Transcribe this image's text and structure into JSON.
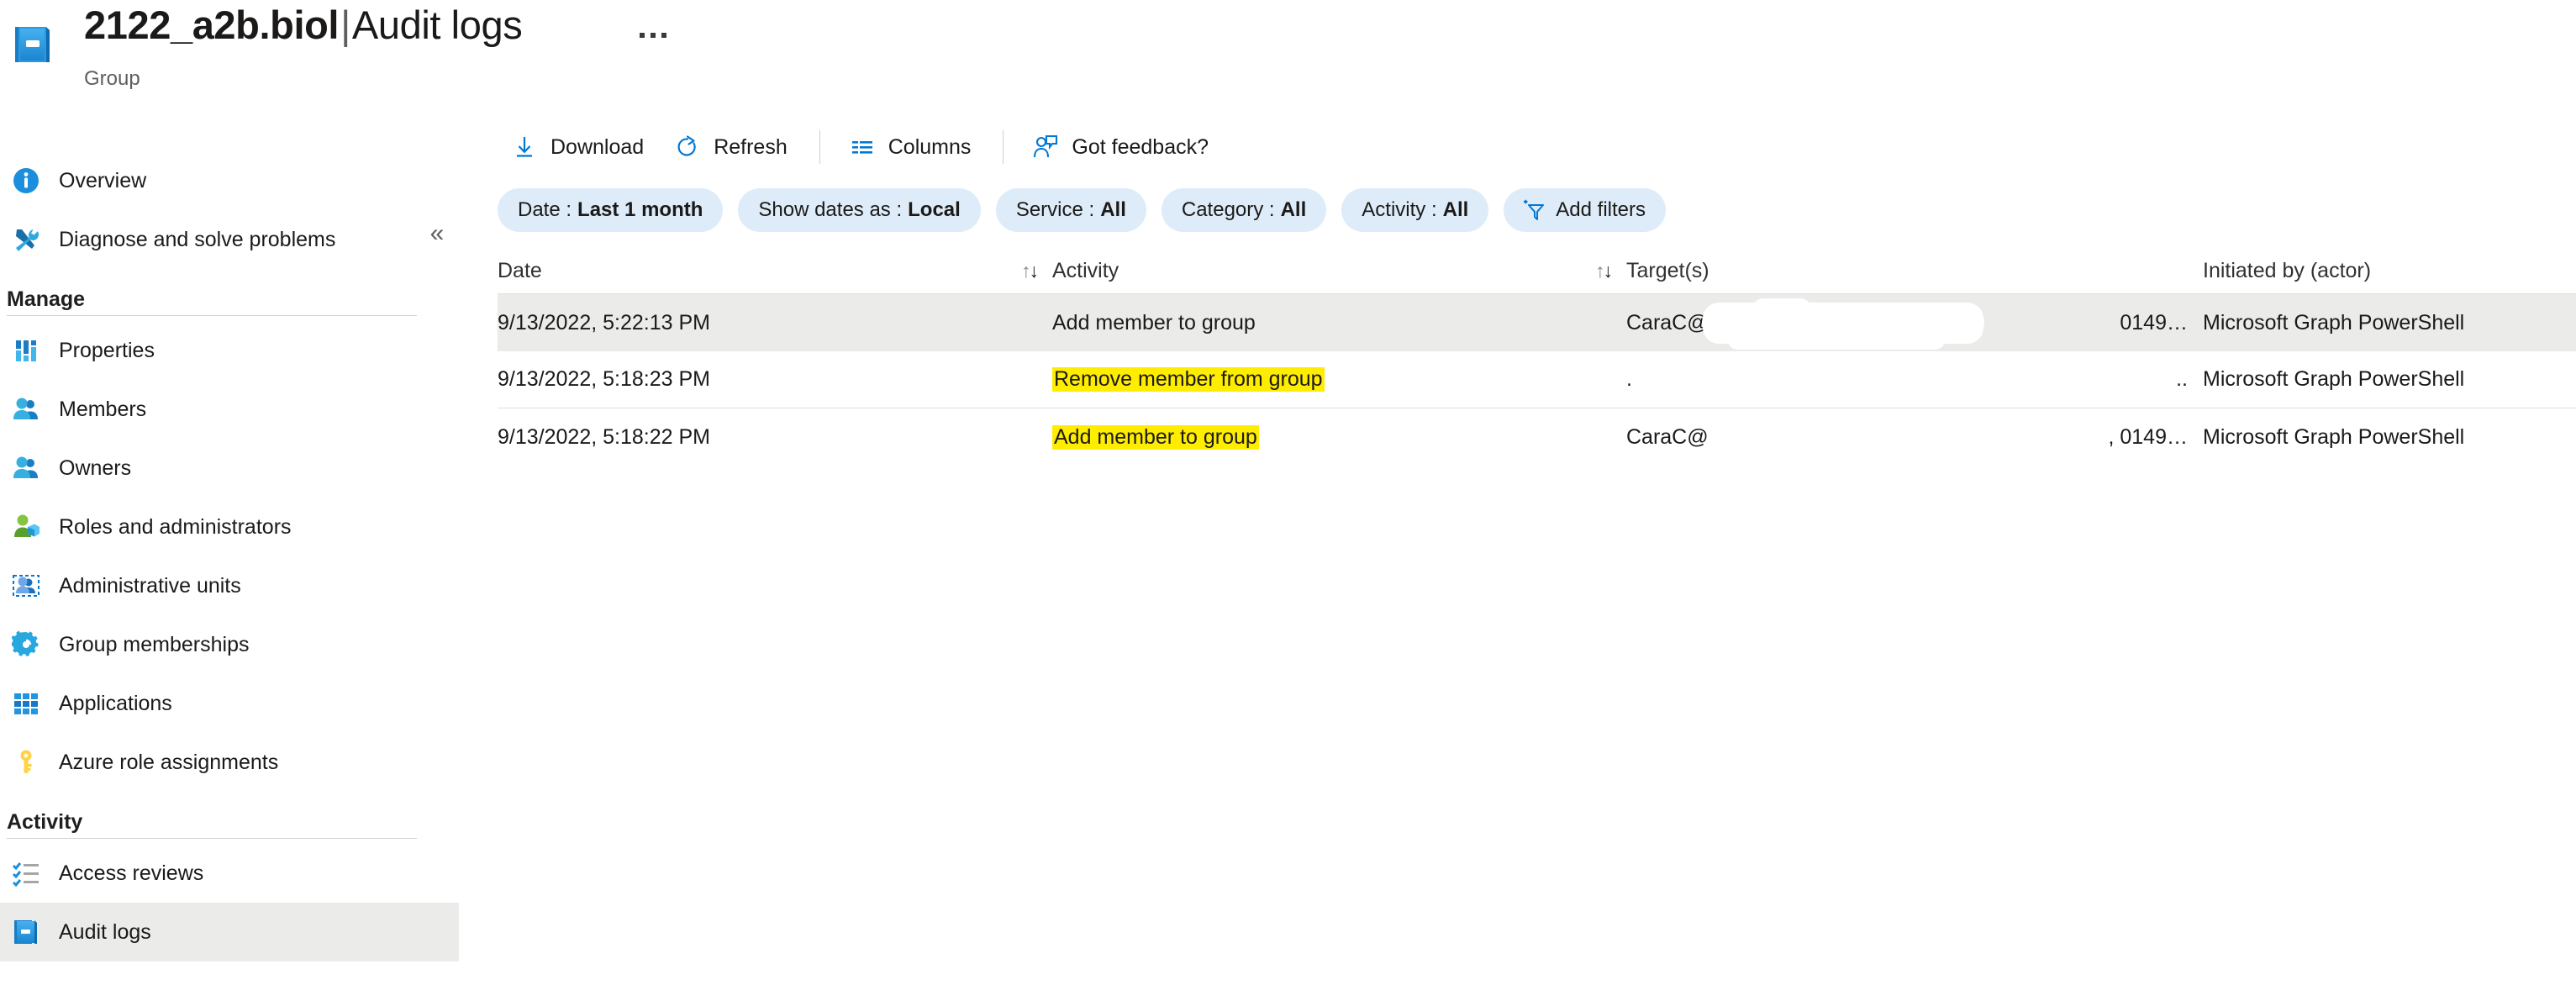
{
  "header": {
    "icon": "group-book-icon",
    "title_main": "2122_a2b.biol",
    "title_separator": "|",
    "title_rest": "Audit logs",
    "more_button": "…",
    "subtitle": "Group"
  },
  "sidebar": {
    "collapse_label": "«",
    "items": [
      {
        "label": "Overview",
        "icon": "info-icon",
        "selected": false
      },
      {
        "label": "Diagnose and solve problems",
        "icon": "wrench-screwdriver-icon",
        "selected": false
      }
    ],
    "sections": [
      {
        "title": "Manage",
        "items": [
          {
            "label": "Properties",
            "icon": "properties-icon",
            "selected": false
          },
          {
            "label": "Members",
            "icon": "members-icon",
            "selected": false
          },
          {
            "label": "Owners",
            "icon": "owners-icon",
            "selected": false
          },
          {
            "label": "Roles and administrators",
            "icon": "roles-administrators-icon",
            "selected": false
          },
          {
            "label": "Administrative units",
            "icon": "administrative-units-icon",
            "selected": false
          },
          {
            "label": "Group memberships",
            "icon": "gear-icon",
            "selected": false
          },
          {
            "label": "Applications",
            "icon": "applications-grid-icon",
            "selected": false
          },
          {
            "label": "Azure role assignments",
            "icon": "key-icon",
            "selected": false
          }
        ]
      },
      {
        "title": "Activity",
        "items": [
          {
            "label": "Access reviews",
            "icon": "access-reviews-icon",
            "selected": false
          },
          {
            "label": "Audit logs",
            "icon": "audit-logs-book-icon",
            "selected": true
          }
        ]
      }
    ]
  },
  "toolbar": {
    "buttons": [
      {
        "label": "Download",
        "icon": "download-icon"
      },
      {
        "label": "Refresh",
        "icon": "refresh-icon"
      },
      {
        "label": "Columns",
        "icon": "columns-icon"
      },
      {
        "label": "Got feedback?",
        "icon": "feedback-person-icon"
      }
    ]
  },
  "filters": {
    "pills": [
      {
        "key": "Date :",
        "value": "Last 1 month"
      },
      {
        "key": "Show dates as :",
        "value": "Local"
      },
      {
        "key": "Service :",
        "value": "All"
      },
      {
        "key": "Category :",
        "value": "All"
      },
      {
        "key": "Activity :",
        "value": "All"
      }
    ],
    "add_filters": {
      "label": "Add filters",
      "icon": "add-filter-funnel-icon"
    }
  },
  "table": {
    "columns": [
      {
        "label": "Date",
        "sortable": true
      },
      {
        "label": "Activity",
        "sortable": true
      },
      {
        "label": "Target(s)",
        "sortable": false
      },
      {
        "label": "Initiated by (actor)",
        "sortable": false
      }
    ],
    "sort_icon_up": "↑",
    "sort_icon_down": "↓",
    "rows": [
      {
        "date": "9/13/2022, 5:22:13 PM",
        "activity": "Add member to group",
        "activity_highlighted": false,
        "target_left": "CaraC@",
        "target_right": "0149…",
        "actor": "Microsoft Graph PowerShell",
        "selected": true,
        "redacted": true
      },
      {
        "date": "9/13/2022, 5:18:23 PM",
        "activity": "Remove member from group",
        "activity_highlighted": true,
        "target_left": ".",
        "target_right": "..",
        "actor": "Microsoft Graph PowerShell",
        "selected": false,
        "redacted": false
      },
      {
        "date": "9/13/2022, 5:18:22 PM",
        "activity": "Add member to group",
        "activity_highlighted": true,
        "target_left": "CaraC@",
        "target_right": ", 0149…",
        "actor": "Microsoft Graph PowerShell",
        "selected": false,
        "redacted": false
      }
    ]
  },
  "colors": {
    "accent_blue": "#0078d4",
    "pill_background": "#deecf9",
    "selected_row": "#ebebea",
    "highlight_yellow": "#ffed00",
    "text_primary": "#1b1a19",
    "text_secondary": "#605e5c"
  }
}
